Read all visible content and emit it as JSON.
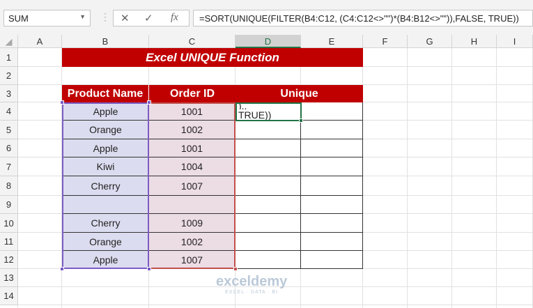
{
  "name_box": "SUM",
  "formula_bar": {
    "cancel": "✕",
    "enter": "✓",
    "fx": "fx",
    "formula": "=SORT(UNIQUE(FILTER(B4:C12, (C4:C12<>\"\")*(B4:B12<>\"\")),FALSE, TRUE))"
  },
  "columns": [
    "A",
    "B",
    "C",
    "D",
    "E",
    "F",
    "G",
    "H",
    "I"
  ],
  "rows": [
    "1",
    "2",
    "3",
    "4",
    "5",
    "6",
    "7",
    "8",
    "9",
    "10",
    "11",
    "12",
    "13",
    "14"
  ],
  "title": "Excel UNIQUE Function",
  "headers": {
    "product": "Product Name",
    "order": "Order ID",
    "unique": "Unique"
  },
  "data": [
    [
      "Apple",
      "1001"
    ],
    [
      "Orange",
      "1002"
    ],
    [
      "Apple",
      "1001"
    ],
    [
      "Kiwi",
      "1004"
    ],
    [
      "Cherry",
      "1007"
    ],
    [
      "",
      ""
    ],
    [
      "Cherry",
      "1009"
    ],
    [
      "Orange",
      "1002"
    ],
    [
      "Apple",
      "1007"
    ]
  ],
  "edit_cell": {
    "line1": "),,",
    "line2": "TRUE))"
  },
  "watermark": {
    "name": "exceldemy",
    "tagline": "EXCEL · DATA · BI"
  }
}
